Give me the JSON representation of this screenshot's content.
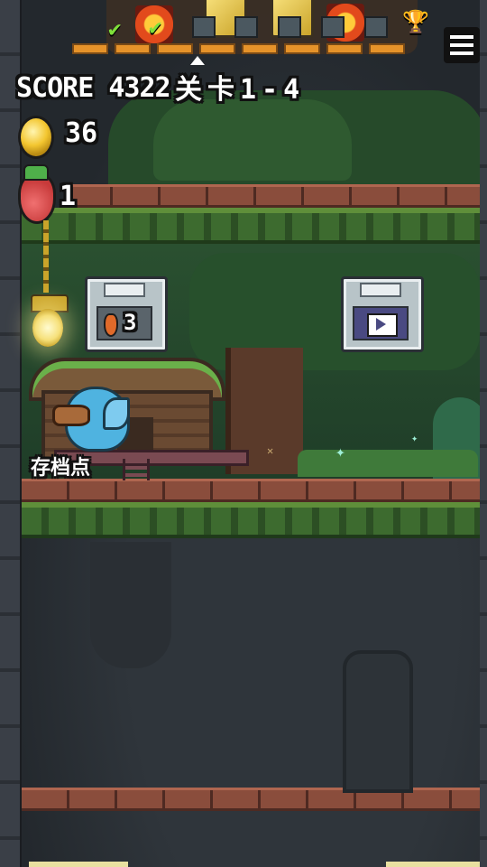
{
  "hud": {
    "score_text": "SCORE 4322",
    "level_text": "关卡1-4",
    "coins": "36",
    "lives": "1"
  },
  "progress": {
    "completed_stages": 2,
    "total_segments": 8
  },
  "cards": {
    "save_cost": "3"
  },
  "checkpoint": {
    "label": "存档点"
  },
  "colors": {
    "progress_fill": "#e6932a",
    "plank": "#8a4d3c",
    "moss": "#3d6b2f",
    "bird": "#4fb3e0"
  }
}
